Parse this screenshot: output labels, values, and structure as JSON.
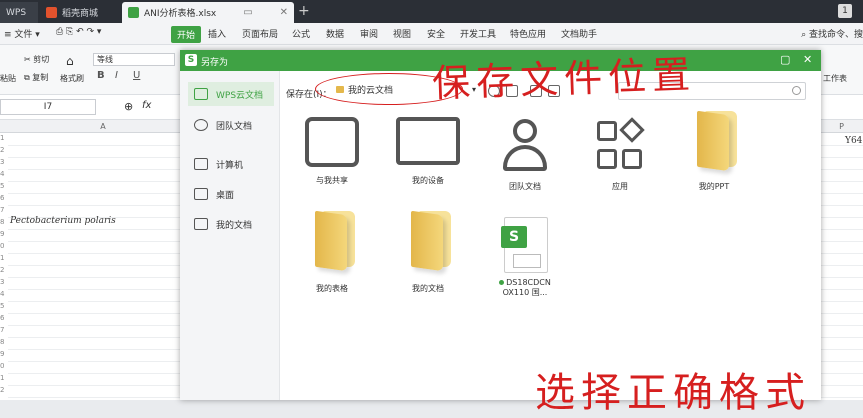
{
  "tabs": [
    {
      "label": "WPS",
      "color": "#c8302c"
    },
    {
      "label": "稻壳商城",
      "color": "#e2522d"
    },
    {
      "label": "ANI分析表格.xlsx",
      "color": "#3fa244"
    }
  ],
  "menus": [
    "文件",
    "开始",
    "插入",
    "页面布局",
    "公式",
    "数据",
    "审阅",
    "视图",
    "安全",
    "开发工具",
    "特色应用",
    "文档助手"
  ],
  "search_command": "查找命令、搜",
  "toolbar": {
    "cut": "剪切",
    "copy": "复制",
    "format_painter": "格式刷",
    "paste": "粘贴",
    "font_name": "等线",
    "bold": "B",
    "italic": "I",
    "underline": "U",
    "worksheet": "工作表"
  },
  "formula_bar": {
    "name_box": "I7",
    "fx": "fx"
  },
  "sheet": {
    "col_a": "A",
    "col_p": "P",
    "cell_p_value": "Y64",
    "cell_species": "Pectobacterium polaris",
    "row_numbers": [
      "1",
      "2",
      "3",
      "4",
      "5",
      "6",
      "7",
      "8",
      "9",
      "0",
      "1",
      "2",
      "3",
      "4",
      "5",
      "6",
      "7",
      "8",
      "9",
      "0",
      "1",
      "2"
    ]
  },
  "dialog": {
    "title": "另存为",
    "logo": "S",
    "sidebar": [
      "WPS云文档",
      "团队文档",
      "计算机",
      "桌面",
      "我的文档"
    ],
    "save_in_label": "保存在(I)：",
    "path": "我的云文档",
    "items": [
      {
        "label": "与我共享",
        "icon": "share-icon"
      },
      {
        "label": "我的设备",
        "icon": "devices-icon"
      },
      {
        "label": "团队文档",
        "icon": "team-icon"
      },
      {
        "label": "应用",
        "icon": "apps-icon"
      },
      {
        "label": "我的PPT",
        "icon": "folder-icon"
      },
      {
        "label": "我的表格",
        "icon": "folder-icon"
      },
      {
        "label": "我的文档",
        "icon": "folder-icon"
      },
      {
        "label": "DS18CDCN\nOX110 国...",
        "icon": "wps-sheet-icon"
      }
    ]
  },
  "annotations": {
    "top": "保存文件位置",
    "bottom": "选择正确格式"
  }
}
